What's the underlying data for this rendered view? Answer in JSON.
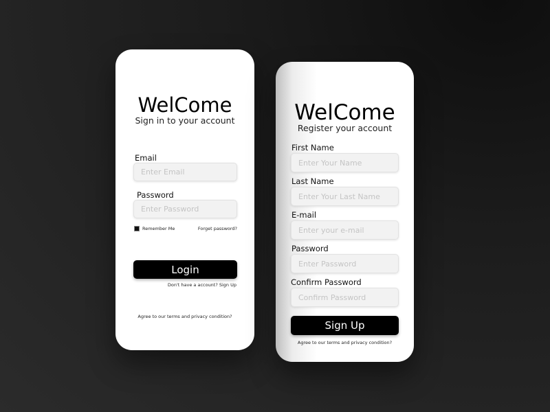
{
  "login": {
    "title": "WelCome",
    "subtitle": "Sign in to your account",
    "email_label": "Email",
    "email_placeholder": "Enter Email",
    "password_label": "Password",
    "password_placeholder": "Enter Password",
    "remember": "Remember Me",
    "remember_checked": true,
    "forgot": "Forget password?",
    "button": "Login",
    "signup_prompt": "Don't have a account? Sign Up",
    "terms": "Agree to our terms and privacy condition?"
  },
  "register": {
    "title": "WelCome",
    "subtitle": "Register your account",
    "fields": [
      {
        "label": "First Name",
        "placeholder": "Enter Your Name"
      },
      {
        "label": "Last Name",
        "placeholder": "Enter Your Last Name"
      },
      {
        "label": "E-mail",
        "placeholder": "Enter your e-mail"
      },
      {
        "label": "Password",
        "placeholder": "Enter Password"
      },
      {
        "label": "Confirm Password",
        "placeholder": "Confirm Password"
      }
    ],
    "button": "Sign Up",
    "terms": "Agree to our terms and privacy condition?"
  }
}
